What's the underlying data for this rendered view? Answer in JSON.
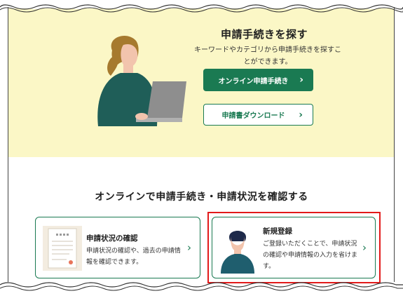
{
  "hero": {
    "title": "申請手続きを探す",
    "description": "キーワードやカテゴリから申請手続きを探すことができます。",
    "primary_button": "オンライン申請手続き",
    "secondary_button": "申請書ダウンロード",
    "chevron": "›"
  },
  "section": {
    "title": "オンラインで申請手続き・申請状況を確認する"
  },
  "cards": [
    {
      "title": "申請状況の確認",
      "text": "申請状況の確認や、過去の申請情報を確認できます。",
      "chevron": "›"
    },
    {
      "title": "新規登録",
      "text": "ご登録いただくことで、申請状況の確認や申請情報の入力を省けます。",
      "chevron": "›"
    }
  ],
  "colors": {
    "hero_bg": "#fbf7c6",
    "accent": "#1a7a52",
    "highlight": "#e21a1a"
  },
  "icons": [
    "person-laptop-illustration",
    "document-illustration",
    "person-avatar-illustration",
    "chevron-right-icon"
  ]
}
